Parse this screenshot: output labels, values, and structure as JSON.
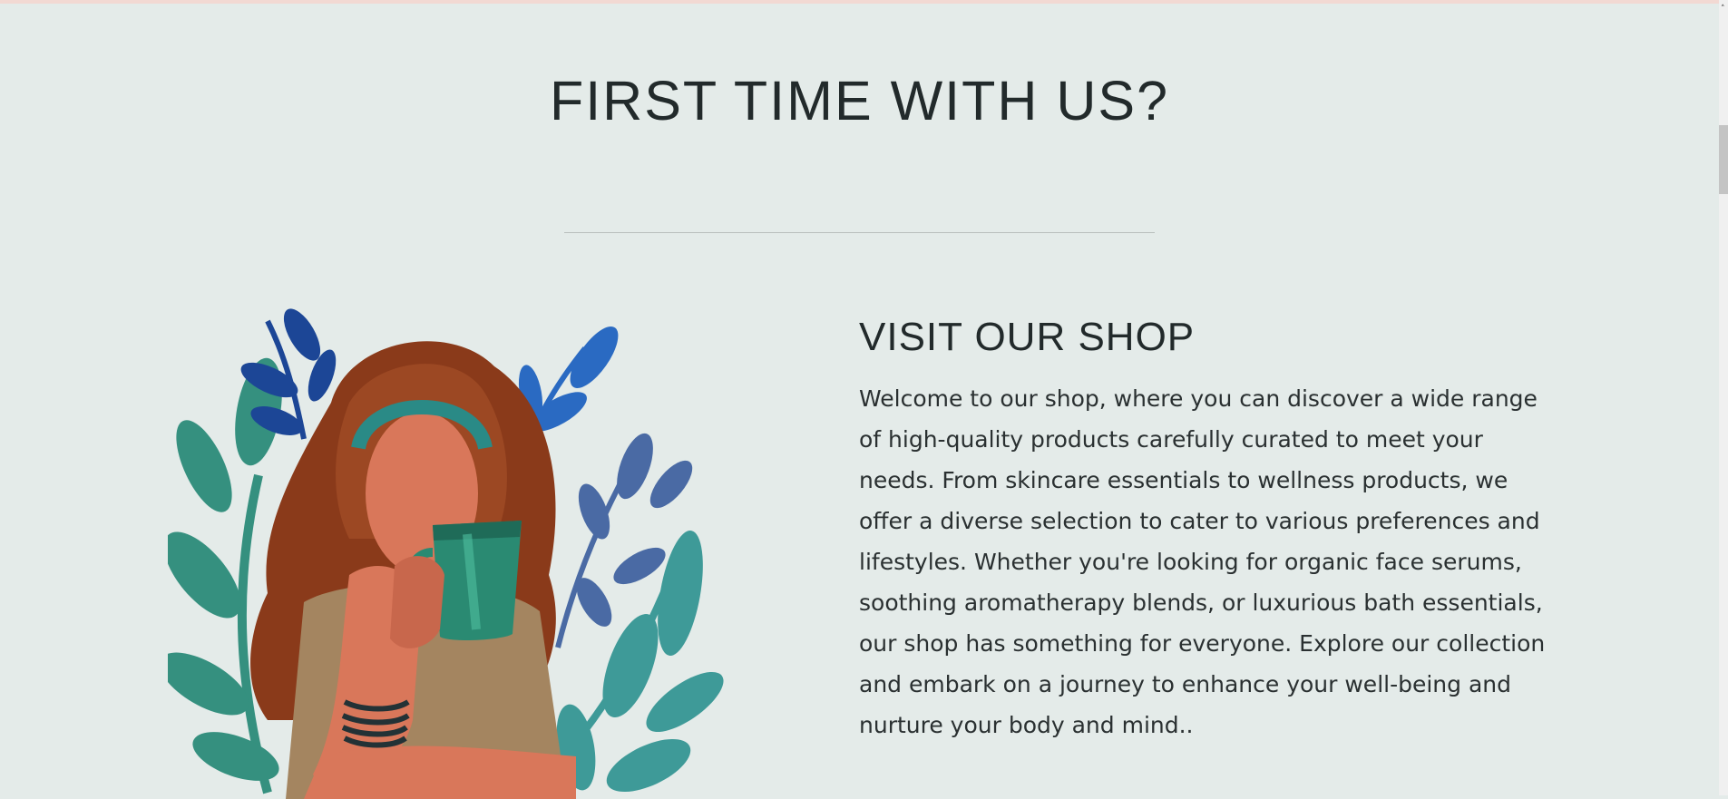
{
  "section": {
    "heading": "FIRST TIME WITH US?"
  },
  "shop": {
    "title": "VISIT OUR SHOP",
    "description": "Welcome to our shop, where you can discover a wide range of high-quality products carefully curated to meet your needs. From skincare essentials to wellness products, we offer a diverse selection to cater to various preferences and lifestyles. Whether you're looking for organic face serums, soothing aromatherapy blends, or luxurious bath essentials, our shop has something for everyone. Explore our collection and embark on a journey to enhance your well-being and nurture your body and mind.."
  },
  "illustration": {
    "subject": "woman-drinking-coffee-illustration"
  },
  "colors": {
    "background": "#e4ebe9",
    "text": "#222a2b",
    "leaf_teal": "#3a9a8c",
    "leaf_blue": "#2c6cc4",
    "leaf_dark_blue": "#1f4aa0",
    "hair": "#8b3a1c",
    "skin": "#d9775a",
    "mug": "#2a8a72",
    "shirt": "#a48560"
  }
}
